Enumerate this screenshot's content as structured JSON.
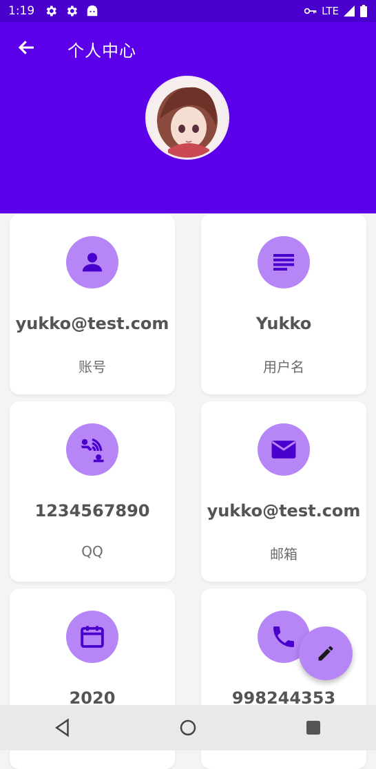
{
  "status_bar": {
    "time": "1:19",
    "network": "LTE",
    "icons": [
      "gear-icon",
      "gear-icon",
      "android-icon",
      "vpn-key-icon",
      "signal-icon",
      "battery-icon"
    ]
  },
  "header": {
    "title": "个人中心",
    "back_icon": "arrow-back-icon",
    "accent": "#5b00e8"
  },
  "cards": [
    {
      "icon": "person-icon",
      "value": "yukko@test.com",
      "label": "账号"
    },
    {
      "icon": "notes-icon",
      "value": "Yukko",
      "label": "用户名"
    },
    {
      "icon": "qq-wave-icon",
      "value": "1234567890",
      "label": "QQ"
    },
    {
      "icon": "mail-icon",
      "value": "yukko@test.com",
      "label": "邮箱"
    },
    {
      "icon": "calendar-icon",
      "value": "2020",
      "label": ""
    },
    {
      "icon": "phone-icon",
      "value": "998244353",
      "label": ""
    }
  ],
  "fab": {
    "icon": "edit-pencil-icon"
  },
  "nav": {
    "buttons": [
      "back-triangle-icon",
      "home-circle-icon",
      "recents-square-icon"
    ]
  },
  "colors": {
    "icon_circle": "#b685f6",
    "icon_fg": "#4a00cc"
  }
}
